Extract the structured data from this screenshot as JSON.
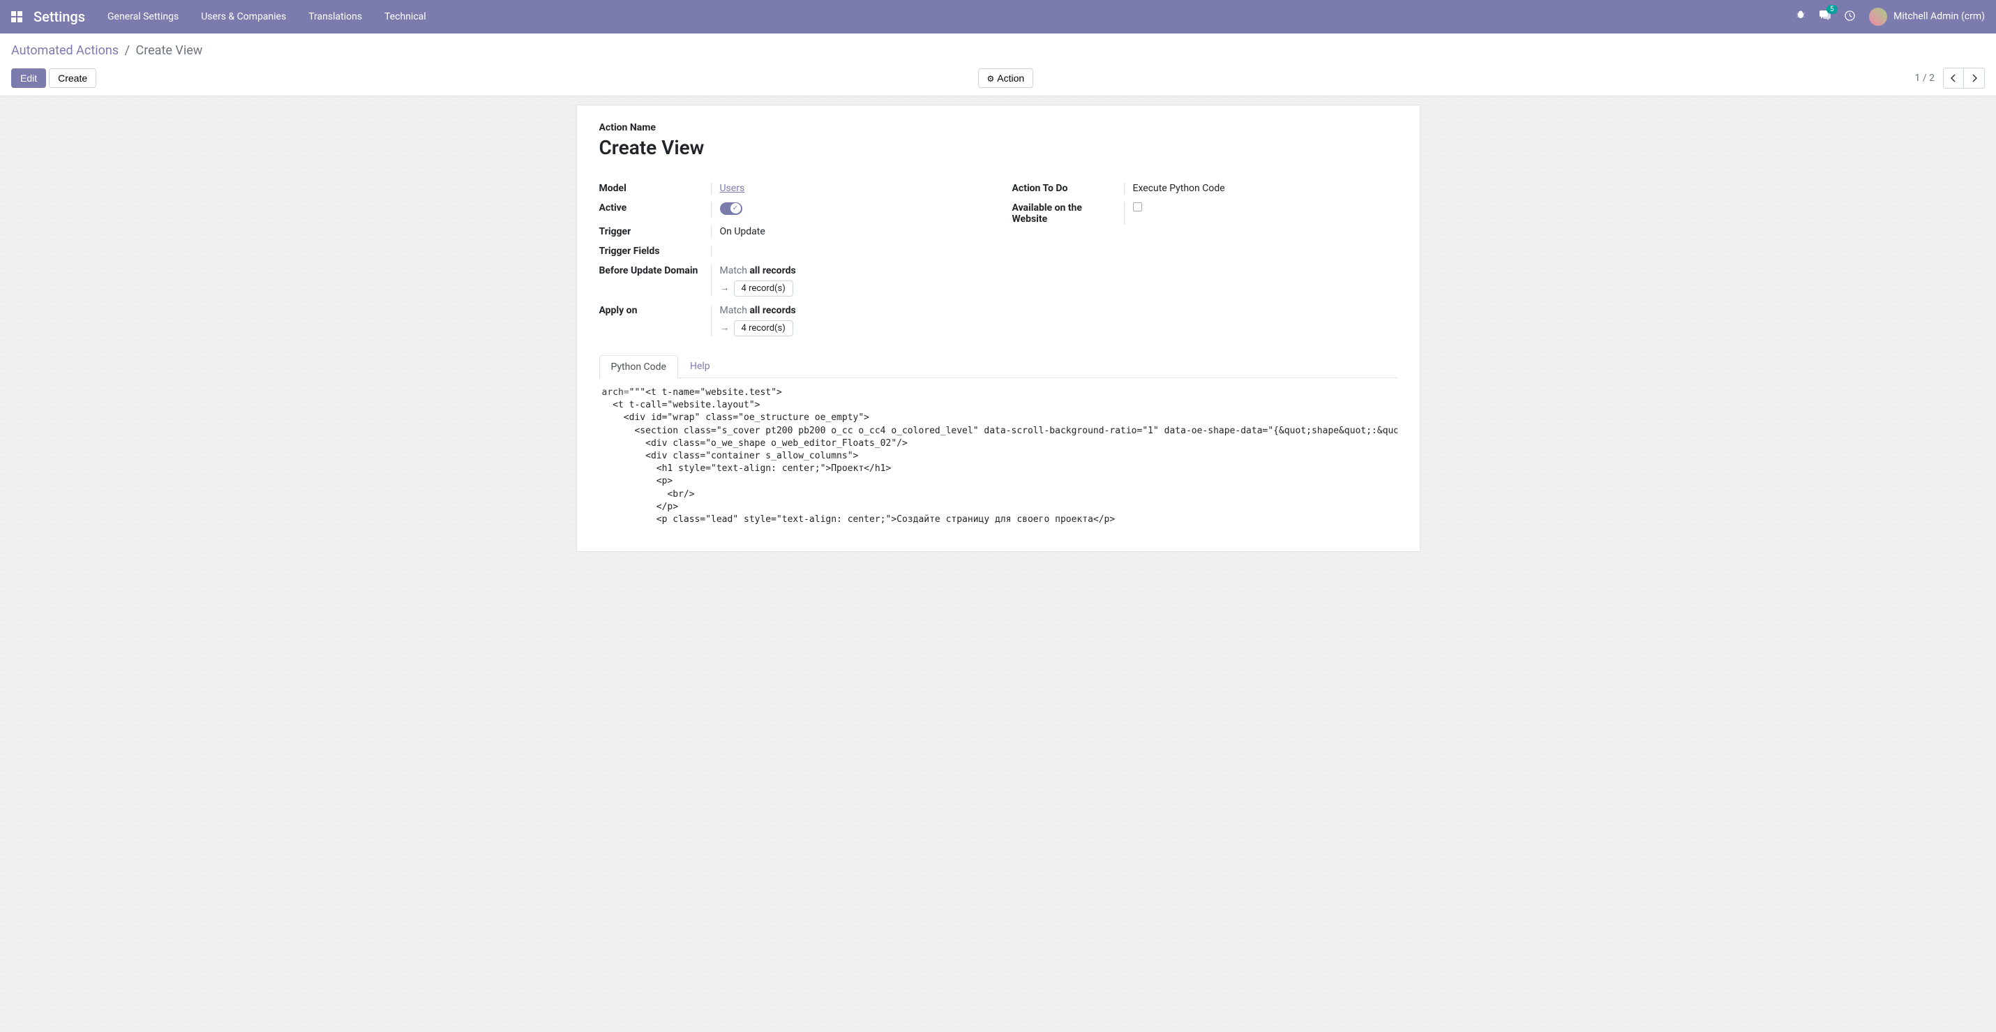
{
  "navbar": {
    "brand": "Settings",
    "menu": [
      "General Settings",
      "Users & Companies",
      "Translations",
      "Technical"
    ],
    "message_count": "5",
    "user_name": "Mitchell Admin (crm)"
  },
  "breadcrumb": {
    "parent": "Automated Actions",
    "sep": "/",
    "current": "Create View"
  },
  "buttons": {
    "edit": "Edit",
    "create": "Create",
    "action": "Action"
  },
  "pager": {
    "text": "1 / 2"
  },
  "form": {
    "title_label": "Action Name",
    "title_value": "Create View",
    "labels": {
      "model": "Model",
      "active": "Active",
      "trigger": "Trigger",
      "trigger_fields": "Trigger Fields",
      "before_update_domain": "Before Update Domain",
      "apply_on": "Apply on",
      "action_to_do": "Action To Do",
      "available_website": "Available on the Website"
    },
    "values": {
      "model": "Users",
      "trigger": "On Update",
      "action_to_do": "Execute Python Code"
    },
    "match_prefix": "Match ",
    "match_bold": "all records",
    "records_count": "4 record(s)"
  },
  "tabs": {
    "python_code": "Python Code",
    "help": "Help"
  },
  "code": {
    "key": "arch",
    "op": "=",
    "body": "\"\"\"<t t-name=\"website.test\">\n  <t t-call=\"website.layout\">\n    <div id=\"wrap\" class=\"oe_structure oe_empty\">\n      <section class=\"s_cover pt200 pb200 o_cc o_cc4 o_colored_level\" data-scroll-background-ratio=\"1\" data-oe-shape-data=\"{&quot;shape&quot;:&quot;w\n        <div class=\"o_we_shape o_web_editor_Floats_02\"/>\n        <div class=\"container s_allow_columns\">\n          <h1 style=\"text-align: center;\">Проект</h1>\n          <p>\n            <br/>\n          </p>\n          <p class=\"lead\" style=\"text-align: center;\">Создайте страницу для своего проекта</p>"
  }
}
